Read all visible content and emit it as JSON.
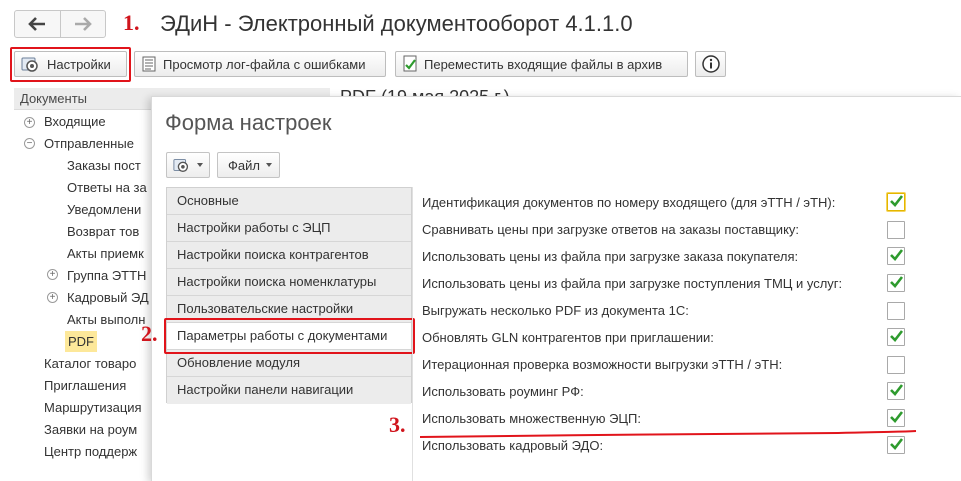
{
  "app": {
    "title": "ЭДиН - Электронный документооборот 4.1.1.0"
  },
  "nav": {
    "back_icon": "arrow-left-icon",
    "forward_icon": "arrow-right-icon"
  },
  "annotations": {
    "step1": "1.",
    "step2": "2.",
    "step3": "3.",
    "color": "#d0141c"
  },
  "toolbar": {
    "settings_label": "Настройки",
    "view_log_label": "Просмотр лог-файла с ошибками",
    "move_archive_label": "Переместить входящие файлы в архив",
    "info_icon": "info-icon"
  },
  "sidebar": {
    "header": "Документы",
    "items": [
      {
        "label": "Входящие",
        "sign": "⊕"
      },
      {
        "label": "Отправленные",
        "sign": "⊖"
      },
      {
        "label": "Заказы пост"
      },
      {
        "label": "Ответы на за"
      },
      {
        "label": "Уведомлени"
      },
      {
        "label": "Возврат тов"
      },
      {
        "label": "Акты приемк"
      },
      {
        "label": "Группа ЭТТН",
        "sign": "⊕"
      },
      {
        "label": "Кадровый ЭД",
        "sign": "⊕"
      },
      {
        "label": "Акты выполн"
      },
      {
        "label": "PDF"
      },
      {
        "label": "Каталог товаро"
      },
      {
        "label": "Приглашения"
      },
      {
        "label": "Маршрутизация"
      },
      {
        "label": "Заявки на роум"
      },
      {
        "label": "Центр поддерж"
      }
    ]
  },
  "document": {
    "title": "PDF (19 мая 2025 г.)"
  },
  "form": {
    "title": "Форма настроек",
    "file_menu_label": "Файл",
    "sections": [
      {
        "label": "Основные"
      },
      {
        "label": "Настройки работы с ЭЦП"
      },
      {
        "label": "Настройки поиска контрагентов"
      },
      {
        "label": "Настройки поиска номенклатуры"
      },
      {
        "label": "Пользовательские настройки"
      },
      {
        "label": "Параметры работы с документами",
        "active": true
      },
      {
        "label": "Обновление модуля"
      },
      {
        "label": "Настройки панели навигации"
      }
    ],
    "options": [
      {
        "label": "Идентификация документов по номеру входящего (для эТТН / эТН):",
        "checked": true
      },
      {
        "label": "Сравнивать цены при загрузке ответов на заказы поставщику:",
        "checked": false
      },
      {
        "label": "Использовать цены из файла при загрузке заказа покупателя:",
        "checked": true
      },
      {
        "label": "Использовать цены из файла при загрузке поступления ТМЦ и услуг:",
        "checked": true
      },
      {
        "label": "Выгружать несколько PDF из документа 1С:",
        "checked": false
      },
      {
        "label": "Обновлять GLN контрагентов при приглашении:",
        "checked": true
      },
      {
        "label": "Итерационная проверка возможности выгрузки эТТН / эТН:",
        "checked": false
      },
      {
        "label": "Использовать роуминг РФ:",
        "checked": true
      },
      {
        "label": "Использовать множественную ЭЦП:",
        "checked": true
      },
      {
        "label": "Использовать кадровый ЭДО:",
        "checked": true
      }
    ]
  },
  "colors": {
    "accent_red": "#e1141b",
    "check_green": "#2e9b2e",
    "selected_tree": "#fde89a"
  }
}
